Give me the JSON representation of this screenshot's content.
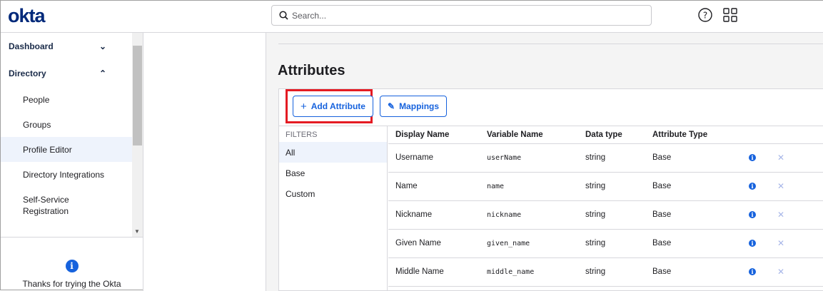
{
  "header": {
    "logo": "okta",
    "search_placeholder": "Search..."
  },
  "sidebar": {
    "sections": [
      {
        "label": "Dashboard"
      },
      {
        "label": "Directory"
      }
    ],
    "items": [
      {
        "label": "People"
      },
      {
        "label": "Groups"
      },
      {
        "label": "Profile Editor"
      },
      {
        "label": "Directory Integrations"
      },
      {
        "label": "Self-Service Registration"
      }
    ],
    "trial_text": "Thanks for trying the Okta"
  },
  "main": {
    "title": "Attributes",
    "add_attribute": "Add Attribute",
    "mappings": "Mappings",
    "filters_title": "FILTERS",
    "filters": [
      {
        "label": "All"
      },
      {
        "label": "Base"
      },
      {
        "label": "Custom"
      }
    ],
    "columns": [
      "Display Name",
      "Variable Name",
      "Data type",
      "Attribute Type"
    ],
    "rows": [
      {
        "display": "Username",
        "variable": "userName",
        "type": "string",
        "attr": "Base"
      },
      {
        "display": "Name",
        "variable": "name",
        "type": "string",
        "attr": "Base"
      },
      {
        "display": "Nickname",
        "variable": "nickname",
        "type": "string",
        "attr": "Base"
      },
      {
        "display": "Given Name",
        "variable": "given_name",
        "type": "string",
        "attr": "Base"
      },
      {
        "display": "Middle Name",
        "variable": "middle_name",
        "type": "string",
        "attr": "Base"
      }
    ]
  },
  "colors": {
    "accent": "#1662dd",
    "highlight": "#e41b23",
    "logo": "#00297a"
  }
}
